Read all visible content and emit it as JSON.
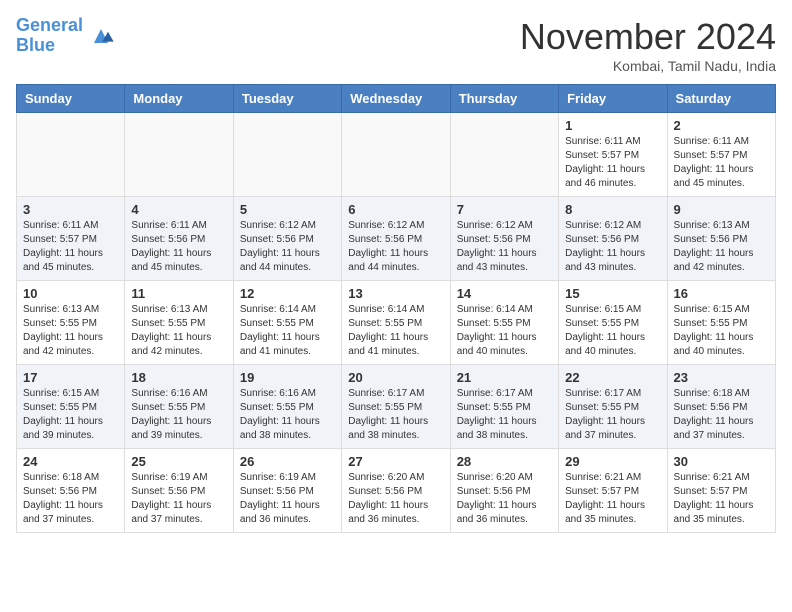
{
  "header": {
    "logo_line1": "General",
    "logo_line2": "Blue",
    "month": "November 2024",
    "location": "Kombai, Tamil Nadu, India"
  },
  "weekdays": [
    "Sunday",
    "Monday",
    "Tuesday",
    "Wednesday",
    "Thursday",
    "Friday",
    "Saturday"
  ],
  "weeks": [
    [
      {
        "day": "",
        "info": ""
      },
      {
        "day": "",
        "info": ""
      },
      {
        "day": "",
        "info": ""
      },
      {
        "day": "",
        "info": ""
      },
      {
        "day": "",
        "info": ""
      },
      {
        "day": "1",
        "info": "Sunrise: 6:11 AM\nSunset: 5:57 PM\nDaylight: 11 hours\nand 46 minutes."
      },
      {
        "day": "2",
        "info": "Sunrise: 6:11 AM\nSunset: 5:57 PM\nDaylight: 11 hours\nand 45 minutes."
      }
    ],
    [
      {
        "day": "3",
        "info": "Sunrise: 6:11 AM\nSunset: 5:57 PM\nDaylight: 11 hours\nand 45 minutes."
      },
      {
        "day": "4",
        "info": "Sunrise: 6:11 AM\nSunset: 5:56 PM\nDaylight: 11 hours\nand 45 minutes."
      },
      {
        "day": "5",
        "info": "Sunrise: 6:12 AM\nSunset: 5:56 PM\nDaylight: 11 hours\nand 44 minutes."
      },
      {
        "day": "6",
        "info": "Sunrise: 6:12 AM\nSunset: 5:56 PM\nDaylight: 11 hours\nand 44 minutes."
      },
      {
        "day": "7",
        "info": "Sunrise: 6:12 AM\nSunset: 5:56 PM\nDaylight: 11 hours\nand 43 minutes."
      },
      {
        "day": "8",
        "info": "Sunrise: 6:12 AM\nSunset: 5:56 PM\nDaylight: 11 hours\nand 43 minutes."
      },
      {
        "day": "9",
        "info": "Sunrise: 6:13 AM\nSunset: 5:56 PM\nDaylight: 11 hours\nand 42 minutes."
      }
    ],
    [
      {
        "day": "10",
        "info": "Sunrise: 6:13 AM\nSunset: 5:55 PM\nDaylight: 11 hours\nand 42 minutes."
      },
      {
        "day": "11",
        "info": "Sunrise: 6:13 AM\nSunset: 5:55 PM\nDaylight: 11 hours\nand 42 minutes."
      },
      {
        "day": "12",
        "info": "Sunrise: 6:14 AM\nSunset: 5:55 PM\nDaylight: 11 hours\nand 41 minutes."
      },
      {
        "day": "13",
        "info": "Sunrise: 6:14 AM\nSunset: 5:55 PM\nDaylight: 11 hours\nand 41 minutes."
      },
      {
        "day": "14",
        "info": "Sunrise: 6:14 AM\nSunset: 5:55 PM\nDaylight: 11 hours\nand 40 minutes."
      },
      {
        "day": "15",
        "info": "Sunrise: 6:15 AM\nSunset: 5:55 PM\nDaylight: 11 hours\nand 40 minutes."
      },
      {
        "day": "16",
        "info": "Sunrise: 6:15 AM\nSunset: 5:55 PM\nDaylight: 11 hours\nand 40 minutes."
      }
    ],
    [
      {
        "day": "17",
        "info": "Sunrise: 6:15 AM\nSunset: 5:55 PM\nDaylight: 11 hours\nand 39 minutes."
      },
      {
        "day": "18",
        "info": "Sunrise: 6:16 AM\nSunset: 5:55 PM\nDaylight: 11 hours\nand 39 minutes."
      },
      {
        "day": "19",
        "info": "Sunrise: 6:16 AM\nSunset: 5:55 PM\nDaylight: 11 hours\nand 38 minutes."
      },
      {
        "day": "20",
        "info": "Sunrise: 6:17 AM\nSunset: 5:55 PM\nDaylight: 11 hours\nand 38 minutes."
      },
      {
        "day": "21",
        "info": "Sunrise: 6:17 AM\nSunset: 5:55 PM\nDaylight: 11 hours\nand 38 minutes."
      },
      {
        "day": "22",
        "info": "Sunrise: 6:17 AM\nSunset: 5:55 PM\nDaylight: 11 hours\nand 37 minutes."
      },
      {
        "day": "23",
        "info": "Sunrise: 6:18 AM\nSunset: 5:56 PM\nDaylight: 11 hours\nand 37 minutes."
      }
    ],
    [
      {
        "day": "24",
        "info": "Sunrise: 6:18 AM\nSunset: 5:56 PM\nDaylight: 11 hours\nand 37 minutes."
      },
      {
        "day": "25",
        "info": "Sunrise: 6:19 AM\nSunset: 5:56 PM\nDaylight: 11 hours\nand 37 minutes."
      },
      {
        "day": "26",
        "info": "Sunrise: 6:19 AM\nSunset: 5:56 PM\nDaylight: 11 hours\nand 36 minutes."
      },
      {
        "day": "27",
        "info": "Sunrise: 6:20 AM\nSunset: 5:56 PM\nDaylight: 11 hours\nand 36 minutes."
      },
      {
        "day": "28",
        "info": "Sunrise: 6:20 AM\nSunset: 5:56 PM\nDaylight: 11 hours\nand 36 minutes."
      },
      {
        "day": "29",
        "info": "Sunrise: 6:21 AM\nSunset: 5:57 PM\nDaylight: 11 hours\nand 35 minutes."
      },
      {
        "day": "30",
        "info": "Sunrise: 6:21 AM\nSunset: 5:57 PM\nDaylight: 11 hours\nand 35 minutes."
      }
    ]
  ]
}
